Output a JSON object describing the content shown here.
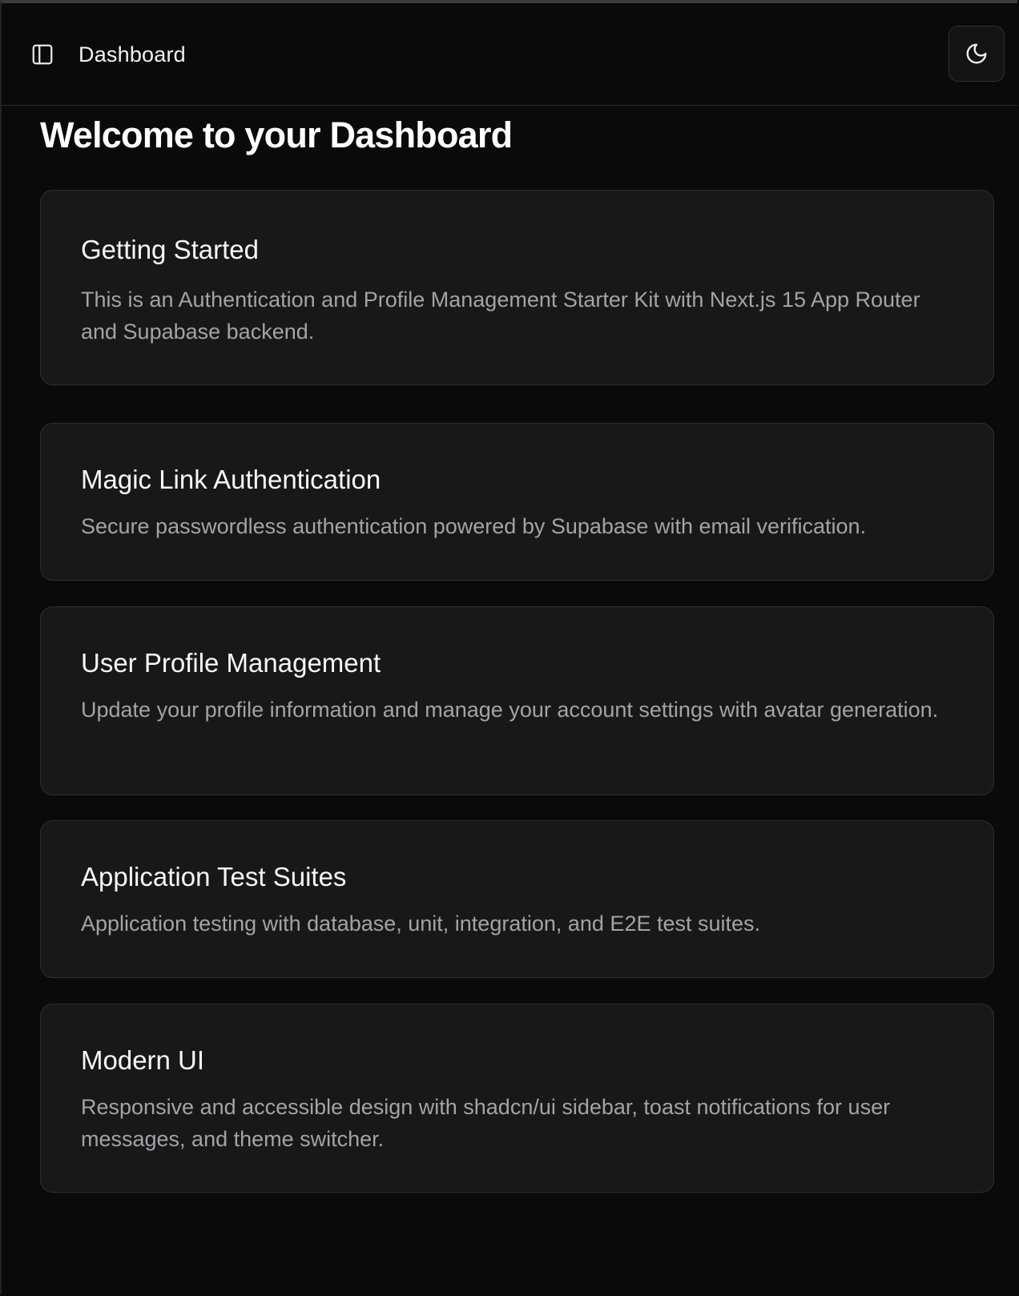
{
  "header": {
    "title": "Dashboard",
    "sidebar_toggle_icon": "sidebar-panel-icon",
    "theme_toggle_icon": "moon-icon"
  },
  "main": {
    "title": "Welcome to your Dashboard",
    "cards": [
      {
        "title": "Getting Started",
        "description": "This is an Authentication and Profile Management Starter Kit with Next.js 15 App Router and Supabase backend."
      },
      {
        "title": "Magic Link Authentication",
        "description": "Secure passwordless authentication powered by Supabase with email verification."
      },
      {
        "title": "User Profile Management",
        "description": "Update your profile information and manage your account settings with avatar generation."
      },
      {
        "title": "Application Test Suites",
        "description": "Application testing with database, unit, integration, and E2E test suites."
      },
      {
        "title": "Modern UI",
        "description": "Responsive and accessible design with shadcn/ui sidebar, toast notifications for user messages, and theme switcher."
      }
    ]
  },
  "colors": {
    "background": "#0a0a0b",
    "card_background": "#181819",
    "card_border": "#2e2e32",
    "muted_text": "#a3a3a8",
    "foreground": "#f5f5f5"
  }
}
